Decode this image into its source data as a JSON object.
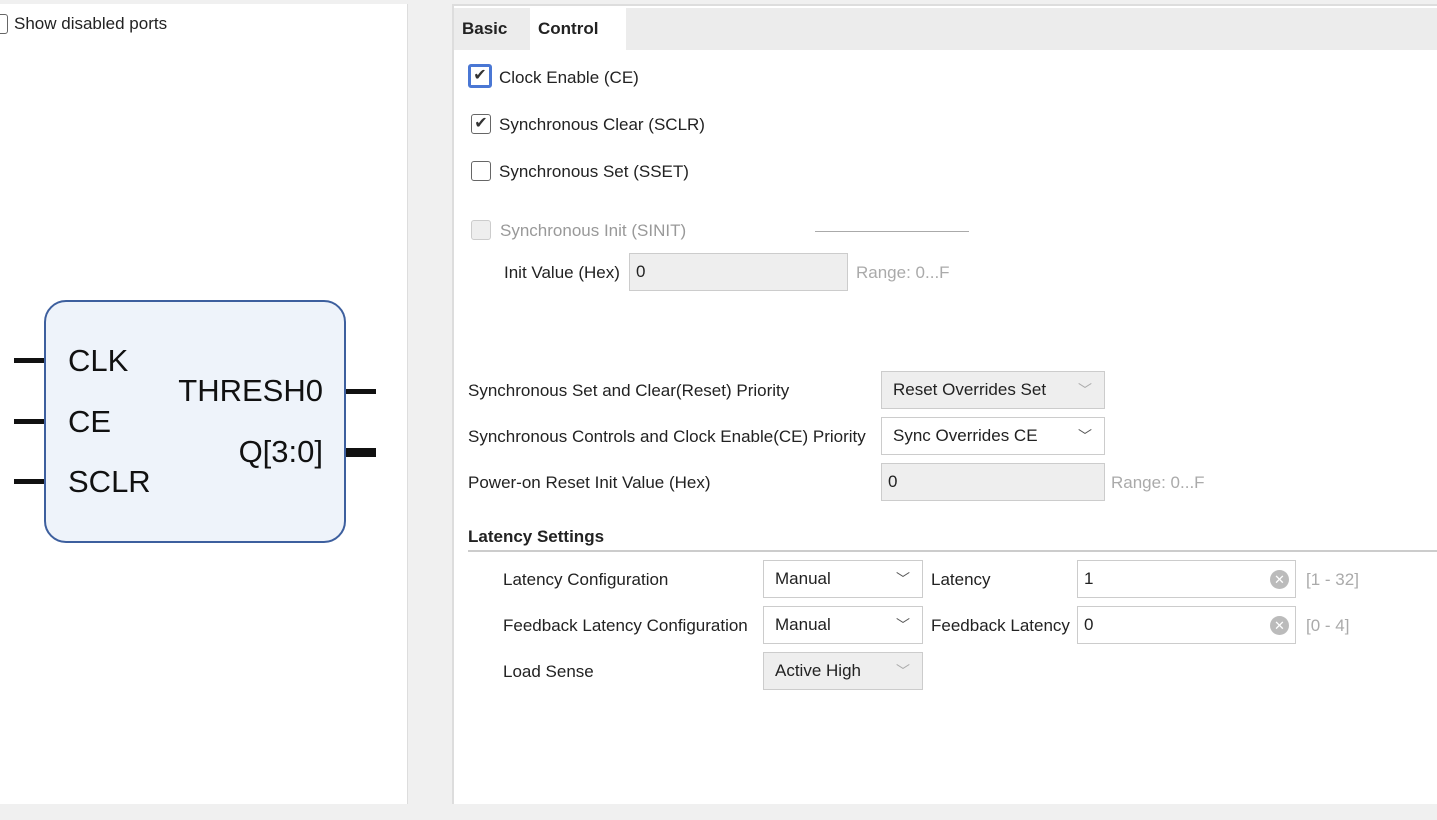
{
  "left": {
    "show_disabled_ports": {
      "label": "Show disabled ports",
      "checked": false
    },
    "symbol": {
      "inputs": [
        "CLK",
        "CE",
        "SCLR"
      ],
      "outputs": [
        "THRESH0",
        "Q[3:0]"
      ]
    }
  },
  "tabs": [
    {
      "label": "Basic",
      "active": false
    },
    {
      "label": "Control",
      "active": true
    }
  ],
  "control": {
    "clock_enable": {
      "label": "Clock Enable (CE)",
      "checked": true
    },
    "sclr": {
      "label": "Synchronous Clear (SCLR)",
      "checked": true
    },
    "sset": {
      "label": "Synchronous Set (SSET)",
      "checked": false
    },
    "sinit": {
      "label": "Synchronous Init (SINIT)",
      "checked": false,
      "disabled": true
    },
    "init_value": {
      "label": "Init Value (Hex)",
      "value": "0",
      "range": "Range: 0...F"
    },
    "set_clear_priority": {
      "label": "Synchronous Set and Clear(Reset) Priority",
      "value": "Reset Overrides Set"
    },
    "ce_priority": {
      "label": "Synchronous Controls and Clock Enable(CE) Priority",
      "value": "Sync Overrides CE"
    },
    "power_on_init": {
      "label": "Power-on Reset Init Value (Hex)",
      "value": "0",
      "range": "Range: 0...F"
    }
  },
  "latency": {
    "title": "Latency Settings",
    "latency_config": {
      "label": "Latency Configuration",
      "value": "Manual"
    },
    "latency": {
      "label": "Latency",
      "value": "1",
      "range": "[1 - 32]"
    },
    "feedback_config": {
      "label": "Feedback Latency Configuration",
      "value": "Manual"
    },
    "feedback_latency": {
      "label": "Feedback Latency",
      "value": "0",
      "range": "[0 - 4]"
    },
    "load_sense": {
      "label": "Load Sense",
      "value": "Active High"
    }
  }
}
